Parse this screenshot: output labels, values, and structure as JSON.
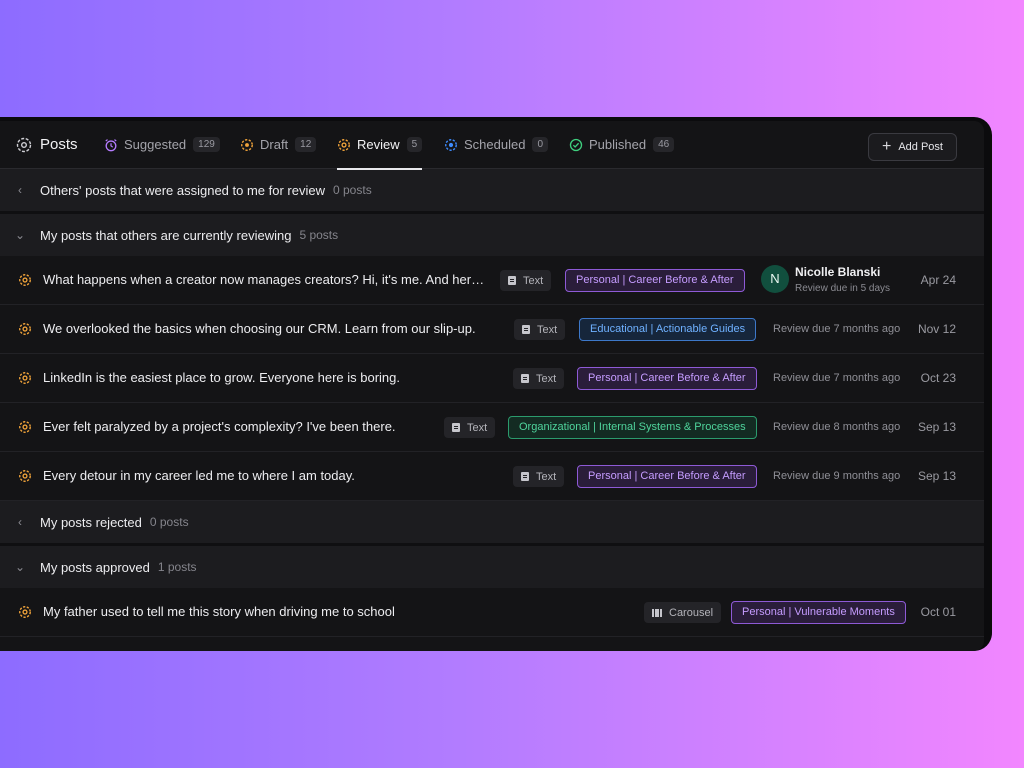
{
  "tabs": [
    {
      "label": "Posts",
      "count": null
    },
    {
      "label": "Suggested",
      "count": "129"
    },
    {
      "label": "Draft",
      "count": "12"
    },
    {
      "label": "Review",
      "count": "5"
    },
    {
      "label": "Scheduled",
      "count": "0"
    },
    {
      "label": "Published",
      "count": "46"
    }
  ],
  "add_button": "Add Post",
  "sections": {
    "others": {
      "title": "Others' posts that were assigned to me for review",
      "count": "0 posts"
    },
    "mine_reviewing": {
      "title": "My posts that others are currently reviewing",
      "count": "5 posts"
    },
    "rejected": {
      "title": "My posts rejected",
      "count": "0 posts"
    },
    "approved": {
      "title": "My posts approved",
      "count": "1 posts"
    }
  },
  "reviewing_rows": [
    {
      "title": "What happens when a creator now manages creators? Hi, it's me. And here's what I learned",
      "format": "Text",
      "tag": "Personal | Career Before & After",
      "reviewer_initial": "N",
      "reviewer_name": "Nicolle Blanski",
      "due": "Review due in 5 days",
      "date": "Apr 24"
    },
    {
      "title": "We overlooked the basics when choosing our CRM. Learn from our slip-up.",
      "format": "Text",
      "tag": "Educational | Actionable Guides",
      "due": "Review due 7 months ago",
      "date": "Nov 12"
    },
    {
      "title": "LinkedIn is the easiest place to grow. Everyone here is boring.",
      "format": "Text",
      "tag": "Personal | Career Before & After",
      "due": "Review due 7 months ago",
      "date": "Oct 23"
    },
    {
      "title": "Ever felt paralyzed by a project's complexity? I've been there.",
      "format": "Text",
      "tag": "Organizational | Internal Systems & Processes",
      "due": "Review due 8 months ago",
      "date": "Sep 13"
    },
    {
      "title": "Every detour in my career led me to where I am today.",
      "format": "Text",
      "tag": "Personal | Career Before & After",
      "due": "Review due 9 months ago",
      "date": "Sep 13"
    }
  ],
  "approved_rows": [
    {
      "title": "My father used to tell me this story when driving me to school",
      "format": "Carousel",
      "tag": "Personal | Vulnerable Moments",
      "date": "Oct 01"
    }
  ],
  "colors": {
    "review_icon": "#f0a33a",
    "suggested_icon": "#b57cff",
    "scheduled_icon": "#3d8bff",
    "published_icon": "#3fcf7e"
  }
}
